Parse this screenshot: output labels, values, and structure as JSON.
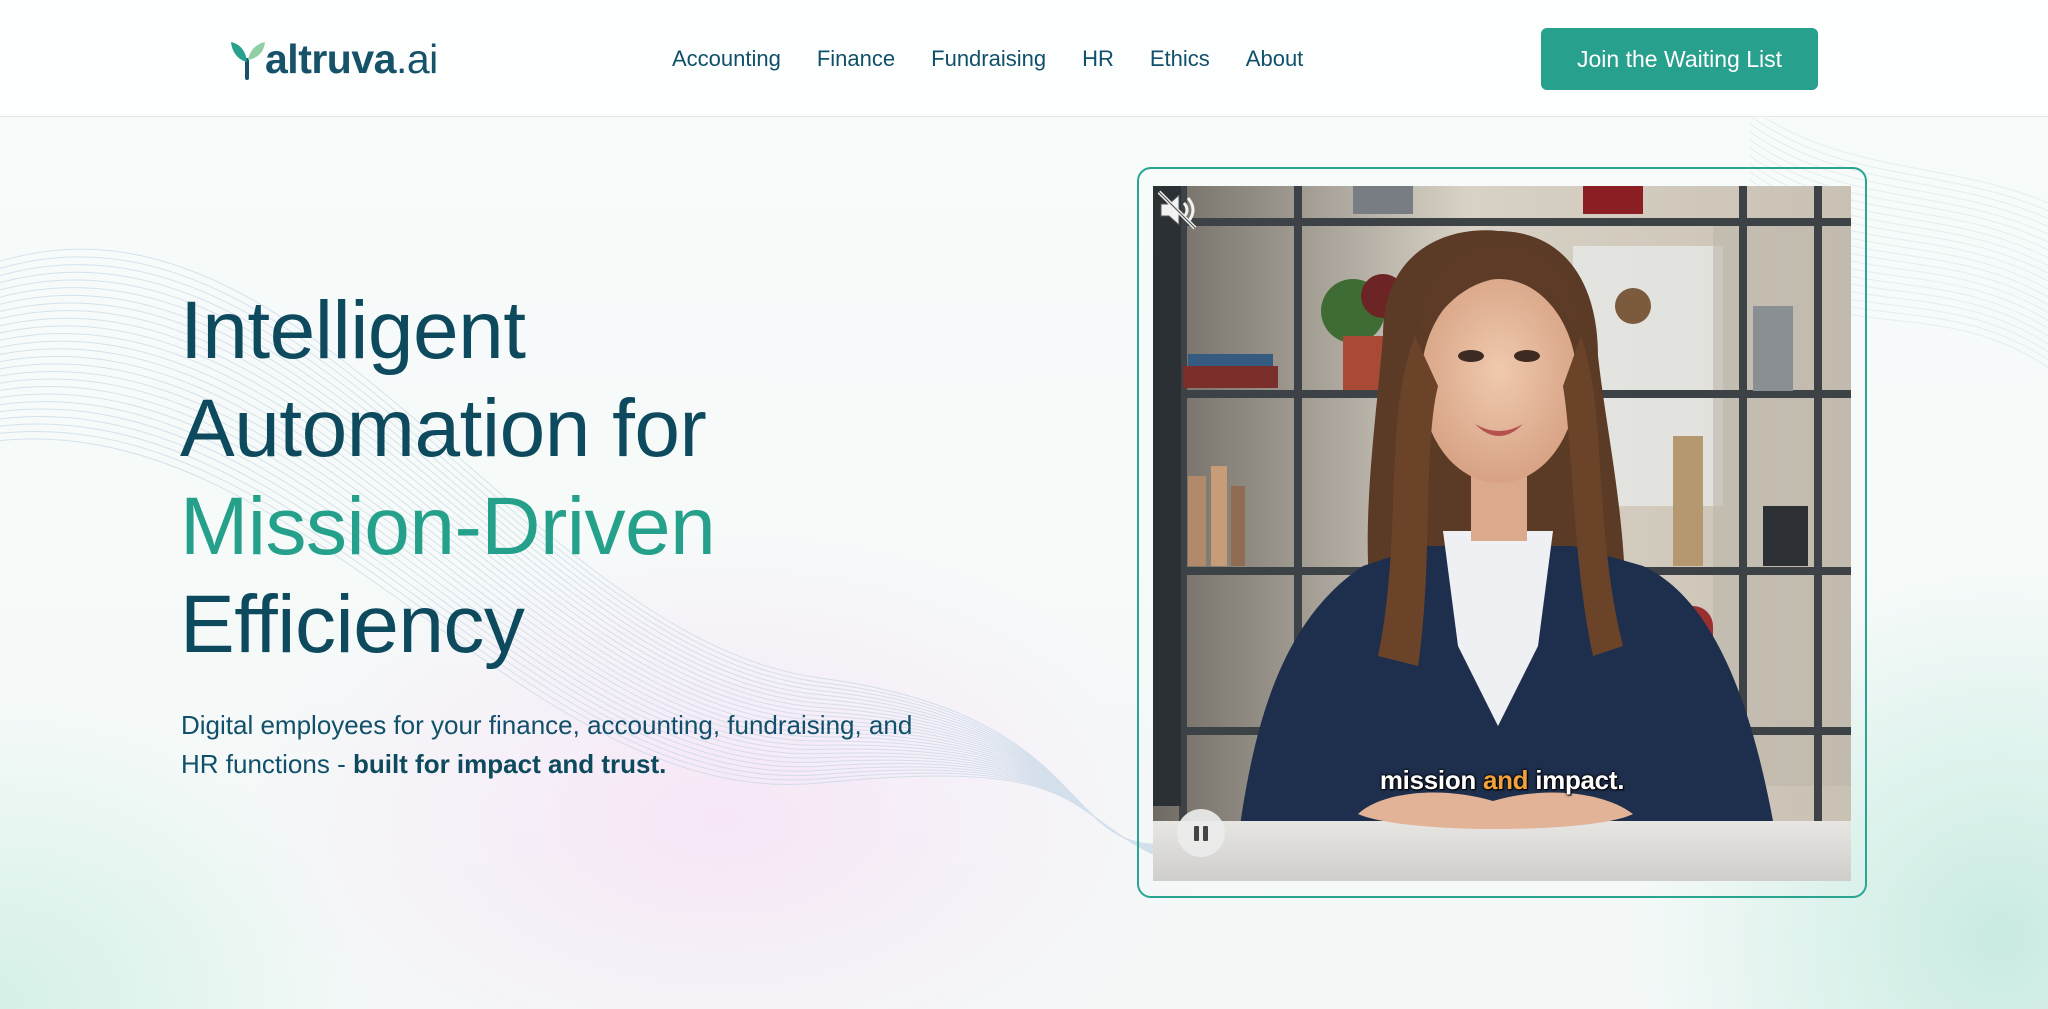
{
  "header": {
    "logo_text": "altruva",
    "logo_suffix": ".ai",
    "nav": [
      "Accounting",
      "Finance",
      "Fundraising",
      "HR",
      "Ethics",
      "About"
    ],
    "cta_label": "Join the Waiting List"
  },
  "hero": {
    "headline_line1": "Intelligent",
    "headline_line2": "Automation for",
    "headline_accent": "Mission-Driven",
    "headline_line4": "Efficiency",
    "subhead_text": "Digital employees for your finance, accounting, fundraising, and HR functions - ",
    "subhead_bold": "built for impact and trust."
  },
  "video": {
    "caption_word1": "mission",
    "caption_word2": "and",
    "caption_word3": "impact.",
    "state": "playing",
    "muted": true
  },
  "colors": {
    "brand_teal": "#27a08e",
    "navy_text": "#0e4a5e",
    "caption_highlight": "#f2a23b"
  }
}
